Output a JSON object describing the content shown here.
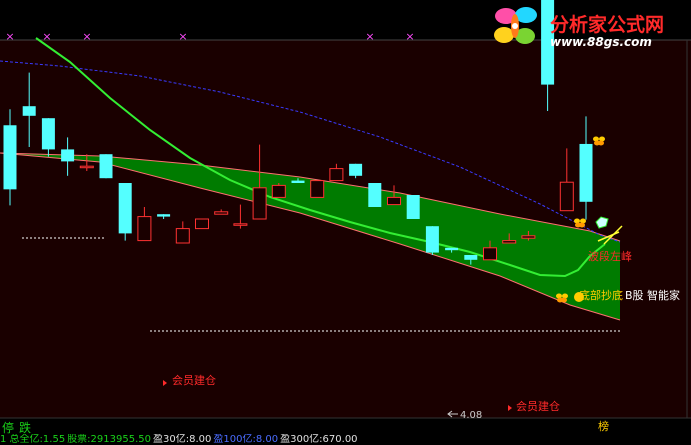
{
  "chart_data": {
    "type": "candlestick",
    "candles": [
      {
        "o": 28.6,
        "h": 30.4,
        "l": 19.6,
        "c": 21.4
      },
      {
        "o": 10.2,
        "h": 11.6,
        "l": 8.5,
        "c": 9.8
      },
      {
        "o": 9.7,
        "h": 9.7,
        "l": 8.1,
        "c": 8.4
      },
      {
        "o": 8.4,
        "h": 8.9,
        "l": 7.3,
        "c": 7.9
      },
      {
        "o": 7.7,
        "h": 8.2,
        "l": 7.5,
        "c": 7.7
      },
      {
        "o": 8.2,
        "h": 8.2,
        "l": 7.2,
        "c": 7.2
      },
      {
        "o": 7.0,
        "h": 7.0,
        "l": 4.6,
        "c": 4.9
      },
      {
        "o": 4.6,
        "h": 6.0,
        "l": 4.6,
        "c": 5.6
      },
      {
        "o": 5.7,
        "h": 5.7,
        "l": 5.5,
        "c": 5.6
      },
      {
        "o": 4.5,
        "h": 5.4,
        "l": 4.5,
        "c": 5.1
      },
      {
        "o": 5.1,
        "h": 5.5,
        "l": 5.1,
        "c": 5.5
      },
      {
        "o": 5.7,
        "h": 5.9,
        "l": 5.7,
        "c": 5.8
      },
      {
        "o": 5.3,
        "h": 6.1,
        "l": 5.1,
        "c": 5.3
      },
      {
        "o": 5.5,
        "h": 8.6,
        "l": 5.5,
        "c": 6.8
      },
      {
        "o": 6.4,
        "h": 7.0,
        "l": 6.4,
        "c": 6.9
      },
      {
        "o": 7.1,
        "h": 7.2,
        "l": 7.0,
        "c": 7.0
      },
      {
        "o": 6.4,
        "h": 7.0,
        "l": 6.4,
        "c": 7.1
      },
      {
        "o": 7.1,
        "h": 7.8,
        "l": 7.1,
        "c": 7.6
      },
      {
        "o": 7.8,
        "h": 7.8,
        "l": 7.2,
        "c": 7.3
      },
      {
        "o": 7.0,
        "h": 7.0,
        "l": 6.0,
        "c": 6.0
      },
      {
        "o": 6.1,
        "h": 6.9,
        "l": 6.1,
        "c": 6.4
      },
      {
        "o": 6.5,
        "h": 6.5,
        "l": 5.5,
        "c": 5.5
      },
      {
        "o": 5.2,
        "h": 5.2,
        "l": 4.0,
        "c": 4.1
      },
      {
        "o": 4.3,
        "h": 4.3,
        "l": 4.1,
        "c": 4.2
      },
      {
        "o": 4.0,
        "h": 4.0,
        "l": 3.6,
        "c": 3.8
      },
      {
        "o": 3.8,
        "h": 4.6,
        "l": 3.8,
        "c": 4.3
      },
      {
        "o": 4.5,
        "h": 4.9,
        "l": 4.5,
        "c": 4.6
      },
      {
        "o": 4.7,
        "h": 5.0,
        "l": 4.6,
        "c": 4.8
      },
      {
        "o": 15.5,
        "h": 17.4,
        "l": 10.0,
        "c": 11.1
      },
      {
        "o": 19.0,
        "h": 26.0,
        "l": 19.0,
        "c": 22.2
      },
      {
        "o": 26.5,
        "h": 29.6,
        "l": 18.0,
        "c": 20.0
      }
    ],
    "price_labels": {
      "low_marker": "4.08"
    },
    "annotations": {
      "member_buy_1": "会员建仓",
      "member_buy_2": "会员建仓",
      "peak": "波段左峰",
      "overlap_text": "底部抄底",
      "board_text": "B股 智能家"
    },
    "symbols": {
      "marker": "×",
      "top_right": "榜"
    }
  },
  "nav": {
    "left": "停",
    "right": "跌"
  },
  "logo": {
    "title": "分析家公式网",
    "url": "www.88gs.com"
  },
  "statusbar": [
    {
      "text": "1 总全亿:1.55",
      "color": "#19d019"
    },
    {
      "text": "股票:2913955.50",
      "color": "#19d019"
    },
    {
      "text": "盈30亿:8.00",
      "color": "#e0e0e0"
    },
    {
      "text": "盈100亿:8.00",
      "color": "#4a6cff"
    },
    {
      "text": "盈300亿:670.00",
      "color": "#e0e0e0"
    }
  ],
  "colors": {
    "rise": "#ff3232",
    "fall": "#54ffff",
    "band_fill": "#007b00",
    "band_top": "#ff7070",
    "band_bottom": "#ff7070",
    "ma_green": "#33ee33",
    "ma_blue": "#3a3aff",
    "bg_top": "#000000",
    "bg_plot": "#1a0000",
    "marker": "#ff4cff",
    "label_red": "#ff2a2a",
    "dotted": "#ffffff"
  }
}
